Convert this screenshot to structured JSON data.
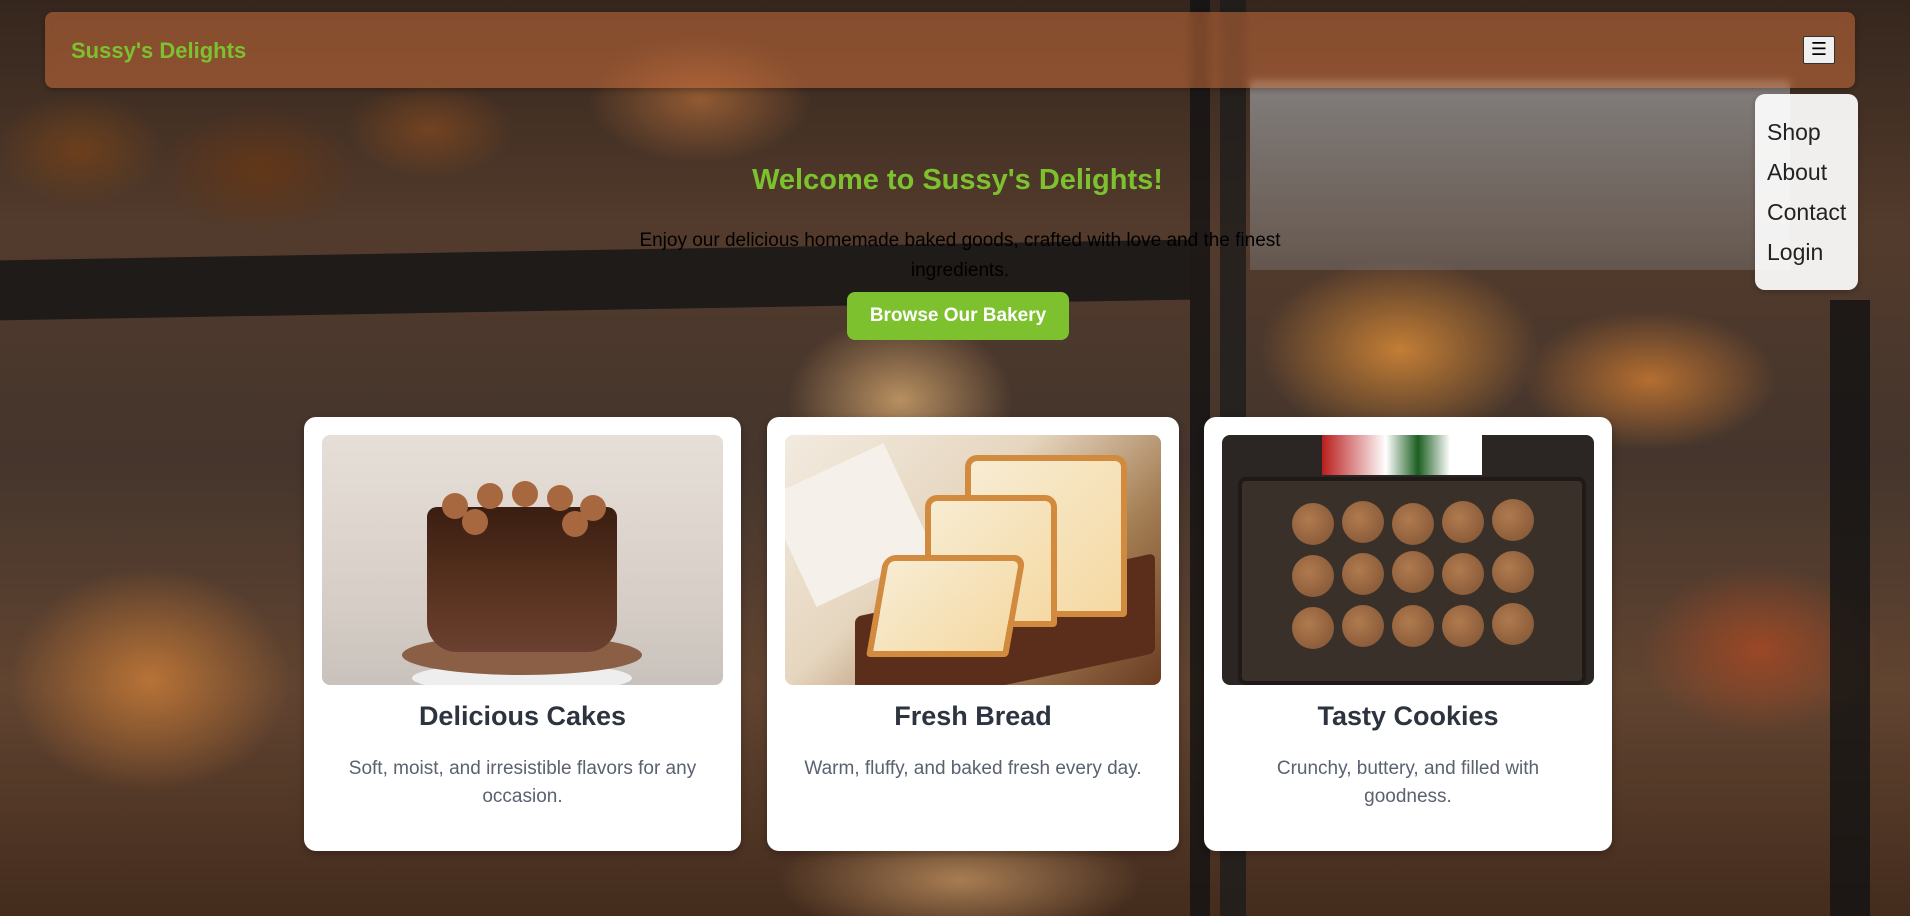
{
  "header": {
    "brand": "Sussy's Delights",
    "menu_icon": "☰"
  },
  "nav": {
    "items": [
      "Shop",
      "About",
      "Contact",
      "Login"
    ]
  },
  "hero": {
    "title": "Welcome to Sussy's Delights!",
    "description": "Enjoy our delicious homemade baked goods, crafted with love and the finest ingredients.",
    "button_label": "Browse Our Bakery"
  },
  "cards": [
    {
      "title": "Delicious Cakes",
      "text": "Soft, moist, and irresistible flavors for any occasion.",
      "image": "chocolate-cake"
    },
    {
      "title": "Fresh Bread",
      "text": "Warm, fluffy, and baked fresh every day.",
      "image": "sliced-bread"
    },
    {
      "title": "Tasty Cookies",
      "text": "Crunchy, buttery, and filled with goodness.",
      "image": "cookie-tray"
    }
  ],
  "colors": {
    "accent": "#7dc12f",
    "card_title": "#2d3440",
    "card_text": "#5a6170"
  }
}
